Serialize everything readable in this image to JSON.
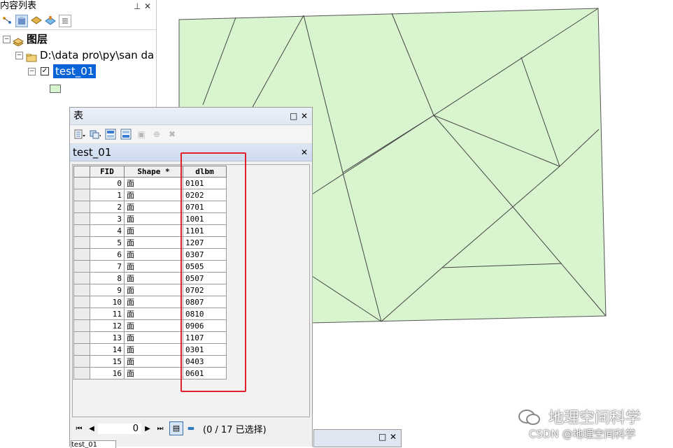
{
  "toc": {
    "title": "内容列表",
    "pin_glyph": "ᚁ",
    "close_glyph": "✕",
    "layers_label": "图层",
    "folder_label": "D:\\data pro\\py\\san da",
    "layer_name": "test_01",
    "layer_checked": true,
    "symbol_color": "#d9f5d0"
  },
  "table_window": {
    "title": "表",
    "table_name": "test_01",
    "columns": [
      "FID",
      "Shape *",
      "dlbm"
    ],
    "rows": [
      {
        "fid": "0",
        "shape": "面",
        "dlbm": "0101"
      },
      {
        "fid": "1",
        "shape": "面",
        "dlbm": "0202"
      },
      {
        "fid": "2",
        "shape": "面",
        "dlbm": "0701"
      },
      {
        "fid": "3",
        "shape": "面",
        "dlbm": "1001"
      },
      {
        "fid": "4",
        "shape": "面",
        "dlbm": "1101"
      },
      {
        "fid": "5",
        "shape": "面",
        "dlbm": "1207"
      },
      {
        "fid": "6",
        "shape": "面",
        "dlbm": "0307"
      },
      {
        "fid": "7",
        "shape": "面",
        "dlbm": "0505"
      },
      {
        "fid": "8",
        "shape": "面",
        "dlbm": "0507"
      },
      {
        "fid": "9",
        "shape": "面",
        "dlbm": "0702"
      },
      {
        "fid": "10",
        "shape": "面",
        "dlbm": "0807"
      },
      {
        "fid": "11",
        "shape": "面",
        "dlbm": "0810"
      },
      {
        "fid": "12",
        "shape": "面",
        "dlbm": "0906"
      },
      {
        "fid": "13",
        "shape": "面",
        "dlbm": "1107"
      },
      {
        "fid": "14",
        "shape": "面",
        "dlbm": "0301"
      },
      {
        "fid": "15",
        "shape": "面",
        "dlbm": "0403"
      },
      {
        "fid": "16",
        "shape": "面",
        "dlbm": "0601"
      }
    ],
    "nav": {
      "current_record": "0",
      "selection_status": "(0 / 17 已选择)"
    },
    "bottom_tab_label": "test_01"
  },
  "map": {
    "fill_color": "#d9f5d0",
    "stroke_color": "#555555"
  },
  "watermark": {
    "line1": "地理空间科学",
    "line2": "CSDN @地理空间科学"
  },
  "colors": {
    "highlight_box": "#e0202a",
    "selection": "#0a64d8"
  }
}
